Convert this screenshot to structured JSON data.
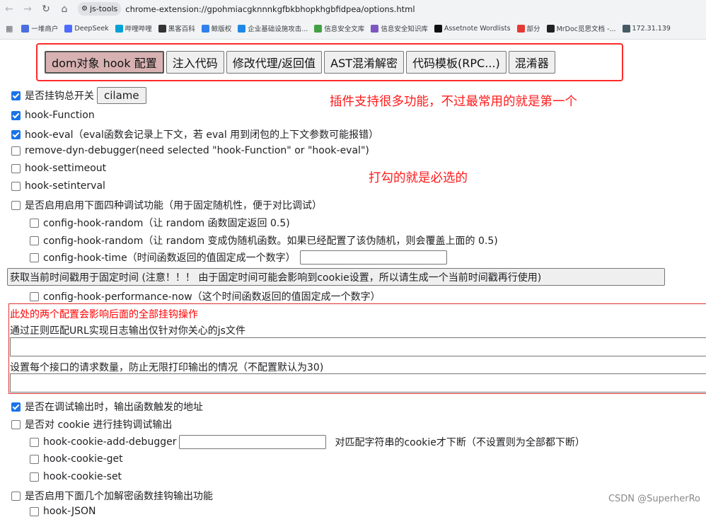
{
  "browser": {
    "chip_label": "js-tools",
    "url": "chrome-extension://gpohmiacgknnnkgfbkbhopkhgbfidpea/options.html",
    "bookmarks": [
      {
        "label": "一堆商户",
        "color": "#4a6ee0"
      },
      {
        "label": "DeepSeek",
        "color": "#4d6bfe"
      },
      {
        "label": "哔哩哔哩",
        "color": "#00a1d6"
      },
      {
        "label": "黑客百科",
        "color": "#333333"
      },
      {
        "label": "鲸版权",
        "color": "#2f80ed"
      },
      {
        "label": "企业基础设施攻击...",
        "color": "#1e88e5"
      },
      {
        "label": "信息安全文库",
        "color": "#43a047"
      },
      {
        "label": "信息安全知识库",
        "color": "#7e57c2"
      },
      {
        "label": "Assetnote Wordlists",
        "color": "#111111"
      },
      {
        "label": "部分",
        "color": "#e53935"
      },
      {
        "label": "MrDoc觅思文档 -...",
        "color": "#222222"
      },
      {
        "label": "172.31.139",
        "color": "#455a64"
      }
    ]
  },
  "tabs": [
    {
      "label": "dom对象 hook 配置",
      "active": true
    },
    {
      "label": "注入代码",
      "active": false
    },
    {
      "label": "修改代理/返回值",
      "active": false
    },
    {
      "label": "AST混淆解密",
      "active": false
    },
    {
      "label": "代码模板(RPC...)",
      "active": false
    },
    {
      "label": "混淆器",
      "active": false
    }
  ],
  "annotations": {
    "top": "插件支持很多功能，不过最常用的就是第一个",
    "middle": "打勾的就是必选的"
  },
  "options": {
    "master": {
      "label": "是否挂钩总开关",
      "checked": true,
      "button": "cilame"
    },
    "hook_function": {
      "label": "hook-Function",
      "checked": true
    },
    "hook_eval": {
      "label": "hook-eval（eval函数会记录上下文，若 eval 用到闭包的上下文参数可能报错）",
      "checked": true
    },
    "remove_dyn_debugger": {
      "label": "remove-dyn-debugger(need selected \"hook-Function\" or \"hook-eval\")",
      "checked": false
    },
    "hook_settimeout": {
      "label": "hook-settimeout",
      "checked": false
    },
    "hook_setinterval": {
      "label": "hook-setinterval",
      "checked": false
    },
    "four_debug": {
      "label": "是否启用启用下面四种调试功能（用于固定随机性，便于对比调试）",
      "checked": false
    },
    "config_random_1": {
      "label": "config-hook-random（让 random 函数固定返回 0.5)",
      "checked": false
    },
    "config_random_2": {
      "label": "config-hook-random（让 random 变成伪随机函数。如果已经配置了该伪随机，则会覆盖上面的 0.5)",
      "checked": false
    },
    "config_time": {
      "label": "config-hook-time（时间函数返回的值固定成一个数字）",
      "checked": false,
      "value": ""
    },
    "get_timestamp_button": "获取当前时间戳用于固定时间 (注意！！！ 由于固定时间可能会影响到cookie设置，所以请生成一个当前时间戳再行使用)",
    "config_perf": {
      "label": "config-hook-performance-now（这个时间函数返回的值固定成一个数字）",
      "checked": false
    }
  },
  "config_box": {
    "title": "此处的两个配置会影响后面的全部挂钩操作",
    "url_filter_label": "通过正则匹配URL实现日志输出仅针对你关心的js文件",
    "url_filter_value": "",
    "max_requests_label": "设置每个接口的请求数量，防止无限打印输出的情况（不配置默认为30)",
    "max_requests_value": ""
  },
  "lower": {
    "print_address": {
      "label": "是否在调试输出时，输出函数触发的地址",
      "checked": true
    },
    "cookie_hook": {
      "label": "是否对 cookie 进行挂钩调试输出",
      "checked": false
    },
    "cookie_add_debugger": {
      "label": "hook-cookie-add-debugger",
      "checked": false,
      "value": "",
      "note": "对匹配字符串的cookie才下断（不设置则为全部都下断）"
    },
    "cookie_get": {
      "label": "hook-cookie-get",
      "checked": false
    },
    "cookie_set": {
      "label": "hook-cookie-set",
      "checked": false
    },
    "crypto_hook": {
      "label": "是否启用下面几个加解密函数挂钩输出功能",
      "checked": false
    },
    "json_partial": {
      "label": "hook-JSON",
      "checked": false
    }
  },
  "watermark": "CSDN @SuperherRo"
}
